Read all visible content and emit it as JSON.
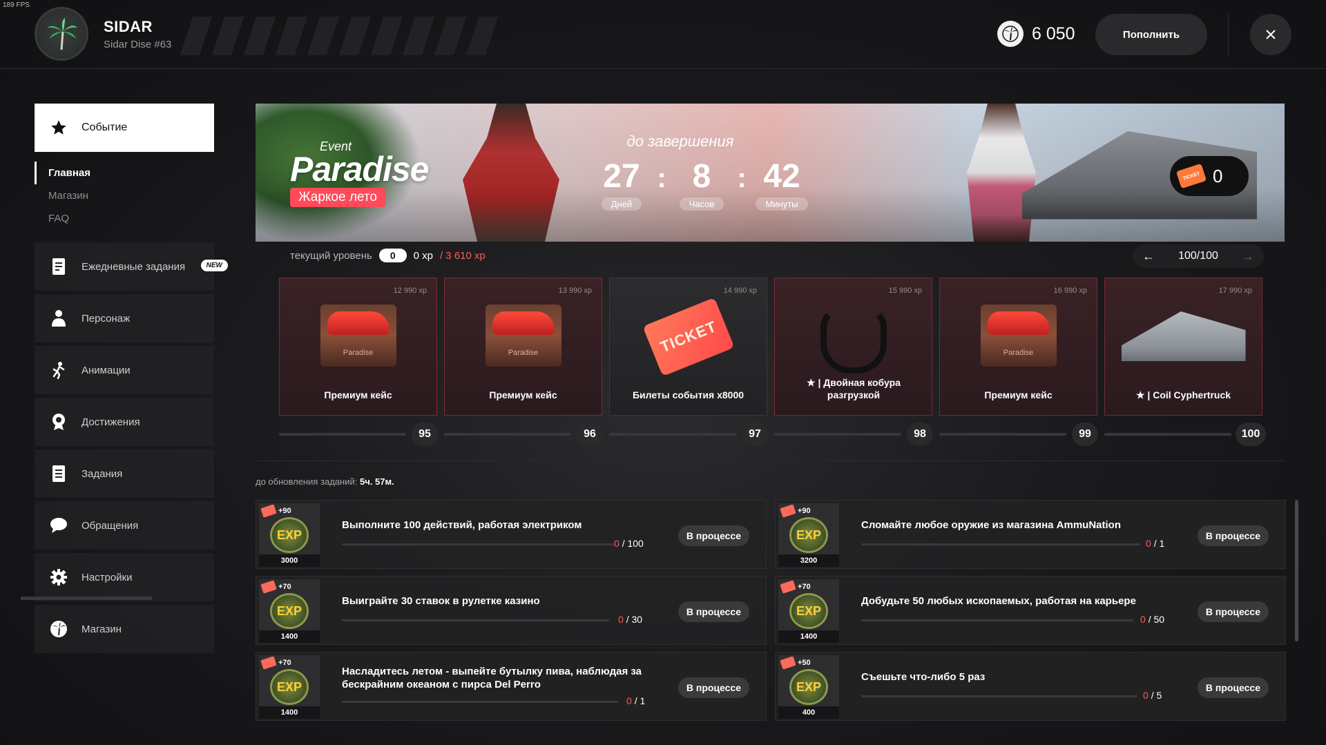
{
  "fps": "189 FPS",
  "header": {
    "username": "SIDAR",
    "usertag": "Sidar Dise #63",
    "coins": "6 050",
    "topup_label": "Пополнить"
  },
  "sidebar": {
    "active": {
      "label": "Событие",
      "icon": "star-icon"
    },
    "subnav": [
      {
        "label": "Главная",
        "active": true
      },
      {
        "label": "Магазин",
        "active": false
      },
      {
        "label": "FAQ",
        "active": false
      }
    ],
    "items": [
      {
        "label": "Ежедневные задания",
        "icon": "daily-tasks-icon",
        "badge": "NEW"
      },
      {
        "label": "Персонаж",
        "icon": "person-icon"
      },
      {
        "label": "Анимации",
        "icon": "dance-icon"
      },
      {
        "label": "Достижения",
        "icon": "achievement-icon"
      },
      {
        "label": "Задания",
        "icon": "tasks-icon"
      },
      {
        "label": "Обращения",
        "icon": "chat-icon"
      },
      {
        "label": "Настройки",
        "icon": "gear-icon"
      },
      {
        "label": "Магазин",
        "icon": "palm-coin-icon"
      }
    ]
  },
  "banner": {
    "event_small": "Event",
    "event_title": "Paradise",
    "event_tag": "Жаркое лето",
    "countdown_title": "до завершения",
    "days": "27",
    "days_label": "Дней",
    "hours": "8",
    "hours_label": "Часов",
    "minutes": "42",
    "minutes_label": "Минуты",
    "tickets": "0"
  },
  "level": {
    "label": "текущий уровень",
    "value": "0",
    "xp_current": "0 xp",
    "xp_max": "/ 3 610 xp",
    "page": "100/100"
  },
  "rewards": [
    {
      "xp": "12 990 xp",
      "name": "Премиум кейс",
      "kind": "case",
      "level": "95",
      "tint": "red"
    },
    {
      "xp": "13 990 xp",
      "name": "Премиум кейс",
      "kind": "case",
      "level": "96",
      "tint": "red"
    },
    {
      "xp": "14 990 xp",
      "name": "Билеты события x8000",
      "kind": "ticket",
      "level": "97",
      "tint": "dark"
    },
    {
      "xp": "15 990 xp",
      "name": "★ | Двойная кобура разгрузкой",
      "kind": "holster",
      "level": "98",
      "tint": "red"
    },
    {
      "xp": "16 990 xp",
      "name": "Премиум кейс",
      "kind": "case",
      "level": "99",
      "tint": "red"
    },
    {
      "xp": "17 990 xp",
      "name": "★ | Coil Cyphertruck",
      "kind": "truck",
      "level": "100",
      "tint": "red"
    }
  ],
  "case_text": "Paradise",
  "ticket_text": "TICKET",
  "tasks_timer": {
    "label": "до обновления заданий:",
    "value": "5ч. 57м."
  },
  "tasks": [
    {
      "plus": "+90",
      "xp": "3000",
      "title": "Выполните 100 действий, работая электриком",
      "cur": "0",
      "total": "/ 100",
      "status": "В процессе"
    },
    {
      "plus": "+90",
      "xp": "3200",
      "title": "Сломайте любое оружие из магазина AmmuNation",
      "cur": "0",
      "total": "/ 1",
      "status": "В процессе"
    },
    {
      "plus": "+70",
      "xp": "1400",
      "title": "Выиграйте 30 ставок в рулетке казино",
      "cur": "0",
      "total": "/ 30",
      "status": "В процессе"
    },
    {
      "plus": "+70",
      "xp": "1400",
      "title": "Добудьте 50 любых ископаемых, работая на карьере",
      "cur": "0",
      "total": "/ 50",
      "status": "В процессе"
    },
    {
      "plus": "+70",
      "xp": "1400",
      "title": "Насладитесь летом - выпейте бутылку пива, наблюдая за бескрайним океаном с пирса Del Perro",
      "cur": "0",
      "total": "/ 1",
      "status": "В процессе"
    },
    {
      "plus": "+50",
      "xp": "400",
      "title": "Съешьте что-либо 5 раз",
      "cur": "0",
      "total": "/ 5",
      "status": "В процессе"
    }
  ],
  "exp_label": "EXP",
  "colors": {
    "accent": "#ff5a5a",
    "tag": "#ff4a5a"
  }
}
